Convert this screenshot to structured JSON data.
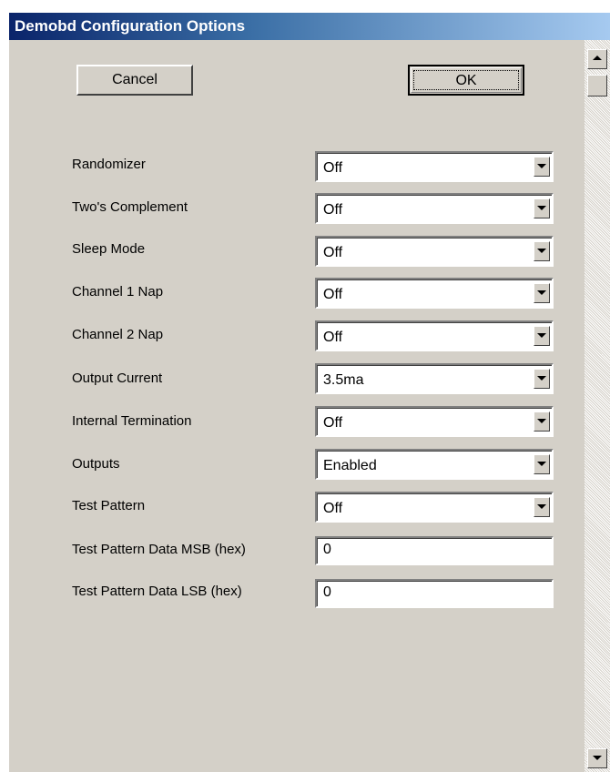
{
  "window": {
    "title": "Demobd Configuration Options"
  },
  "buttons": {
    "cancel_label": "Cancel",
    "ok_label": "OK"
  },
  "settings": [
    {
      "label": "Randomizer",
      "value": "Off"
    },
    {
      "label": "Two's Complement",
      "value": "Off"
    },
    {
      "label": "Sleep Mode",
      "value": "Off"
    },
    {
      "label": "Channel 1 Nap",
      "value": "Off"
    },
    {
      "label": "Channel 2 Nap",
      "value": "Off"
    },
    {
      "label": "Output Current",
      "value": "3.5ma"
    },
    {
      "label": "Internal Termination",
      "value": "Off"
    },
    {
      "label": "Outputs",
      "value": "Enabled"
    },
    {
      "label": "Test Pattern",
      "value": "Off"
    }
  ],
  "text_fields": [
    {
      "label": "Test Pattern Data MSB (hex)",
      "value": "0"
    },
    {
      "label": "Test Pattern Data LSB (hex)",
      "value": "0"
    }
  ],
  "icons": {
    "dropdown": "chevron-down-icon",
    "scroll_up": "arrow-up-icon",
    "scroll_down": "arrow-down-icon"
  },
  "colors": {
    "titlebar_start": "#0a246a",
    "titlebar_end": "#a6caf0",
    "window_bg": "#d4d0c8"
  }
}
